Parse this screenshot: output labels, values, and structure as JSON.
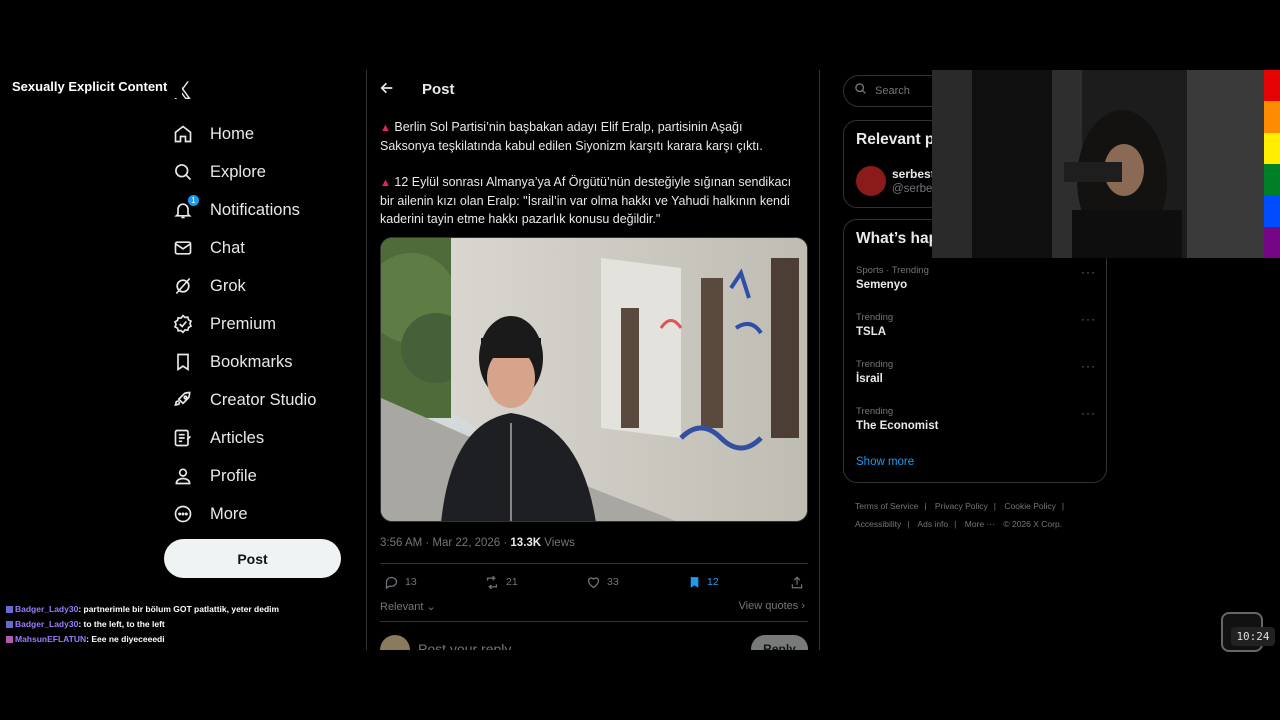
{
  "overlay": {
    "explicit_label": "Sexually Explicit Content"
  },
  "nav": {
    "logo": "𝕏",
    "items": [
      {
        "label": "Home",
        "icon": "home-icon"
      },
      {
        "label": "Explore",
        "icon": "search-icon"
      },
      {
        "label": "Notifications",
        "icon": "bell-icon",
        "badge": "1"
      },
      {
        "label": "Chat",
        "icon": "mail-icon"
      },
      {
        "label": "Grok",
        "icon": "grok-icon"
      },
      {
        "label": "Premium",
        "icon": "verified-icon"
      },
      {
        "label": "Bookmarks",
        "icon": "bookmark-icon"
      },
      {
        "label": "Creator Studio",
        "icon": "rocket-icon"
      },
      {
        "label": "Articles",
        "icon": "article-icon"
      },
      {
        "label": "Profile",
        "icon": "person-icon"
      },
      {
        "label": "More",
        "icon": "more-circle-icon"
      }
    ],
    "post_button": "Post"
  },
  "chat": [
    {
      "user": "Badger_Lady30",
      "message": "partnerimle bir bölum GOT patlattik, yeter dedim"
    },
    {
      "user": "Badger_Lady30",
      "message": "to the left, to the left"
    },
    {
      "user": "MahsunEFLATUN",
      "message": "Eee ne diyeceeedi"
    }
  ],
  "post": {
    "header_title": "Post",
    "paragraph1_marker": "▲",
    "paragraph1": "Berlin Sol Partisi’nin başbakan adayı Elif Eralp, partisinin Aşağı Saksonya teşkilatında kabul edilen Siyonizm karşıtı karara karşı çıktı.",
    "paragraph2_marker": "▲",
    "paragraph2": "12 Eylül sonrası Almanya’ya Af Örgütü’nün desteğiyle sığınan sendikacı bir ailenin kızı olan Eralp: \"İsrail’in var olma hakkı ve Yahudi halkının kendi kaderini tayin etme hakkı pazarlık konusu değildir.\"",
    "timestamp": "3:56 AM · Mar 22, 2026 · ",
    "views_count": "13.3K",
    "views_label": " Views",
    "replies": "13",
    "reposts": "21",
    "likes": "33",
    "bookmarks": "12",
    "sort_label": "Relevant",
    "view_quotes": "View quotes",
    "reply_placeholder": "Post your reply",
    "reply_button": "Reply"
  },
  "right": {
    "search_placeholder": "Search",
    "relevant_title": "Relevant p",
    "relevant_name": "serbest",
    "relevant_handle": "@serbes",
    "happening_title": "What’s hap",
    "trends": [
      {
        "category": "Sports · Trending",
        "name": "Semenyo"
      },
      {
        "category": "Trending",
        "name": "TSLA"
      },
      {
        "category": "Trending",
        "name": "İsrail"
      },
      {
        "category": "Trending",
        "name": "The Economist"
      }
    ],
    "show_more": "Show more",
    "footer": {
      "terms": "Terms of Service",
      "privacy": "Privacy Policy",
      "cookie": "Cookie Policy",
      "accessibility": "Accessibility",
      "ads": "Ads info",
      "more": "More ···",
      "copyright": "© 2026 X Corp."
    }
  },
  "clock": "10:24",
  "colors": {
    "accent": "#1d9bf0",
    "marker": "#e0245e",
    "rainbow": [
      "#e40303",
      "#ff8c00",
      "#ffed00",
      "#008026",
      "#004dff",
      "#750787"
    ]
  }
}
